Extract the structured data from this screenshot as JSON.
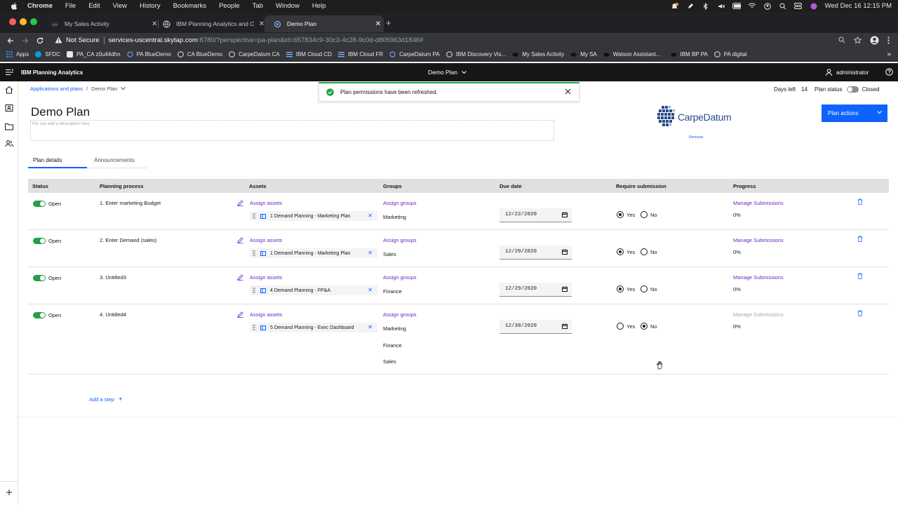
{
  "macos": {
    "app": "Chrome",
    "menus": [
      "File",
      "Edit",
      "View",
      "History",
      "Bookmarks",
      "People",
      "Tab",
      "Window",
      "Help"
    ],
    "clock": "Wed Dec 16  12:15 PM"
  },
  "browser": {
    "tabs": [
      {
        "title": "My Sales Activity"
      },
      {
        "title": "IBM Planning Analytics and Co"
      },
      {
        "title": "Demo Plan"
      }
    ],
    "security": "Not Secure",
    "url_host": "services-uscentral.skytap.com",
    "url_path": ":8780/?perspective=pa-plan&id=657834c9-30c3-4c28-9c0d-d805963d1846#",
    "bookmarks": [
      "Apps",
      "SFDC",
      "PA_CA z0u44dhn",
      "PA BlueDemo",
      "CA BlueDemo",
      "CarpeDatum CA",
      "IBM Cloud CD",
      "IBM Cloud FR",
      "CarpeDatum PA",
      "IBM Discovery Vis...",
      "My Sales Activity",
      "My SA",
      "Watson Assistant...",
      "IBM BP PA",
      "PA digital"
    ]
  },
  "app": {
    "brand": "IBM Planning Analytics",
    "plan_selector": "Demo Plan",
    "user": "administrator"
  },
  "breadcrumb": {
    "root": "Applications and plans",
    "current": "Demo Plan"
  },
  "toast": {
    "message": "Plan permissions have been refreshed."
  },
  "plan_status": {
    "days_left_label": "Days left",
    "days_left": "14",
    "status_label": "Plan status",
    "status": "Closed"
  },
  "plan": {
    "title": "Demo Plan",
    "description_placeholder": "You can add a description here",
    "logo_text": "CarpeDatum",
    "remove_label": "Remove",
    "actions_label": "Plan actions"
  },
  "tabs": [
    "Plan details",
    "Announcements"
  ],
  "columns": [
    "Status",
    "Planning process",
    "Assets",
    "Groups",
    "Due date",
    "Require submission",
    "Progress"
  ],
  "labels": {
    "assign_assets": "Assign assets",
    "assign_groups": "Assign groups",
    "manage_submissions": "Manage Submissions",
    "yes": "Yes",
    "no": "No",
    "add_step": "Add a step"
  },
  "rows": [
    {
      "status": "Open",
      "process": "1. Enter marketing Budget",
      "asset": "1 Demand Planning - Marketing Plan",
      "groups": [
        "Marketing"
      ],
      "due": "12/22/2020",
      "require": "Yes",
      "progress": "0%"
    },
    {
      "status": "Open",
      "process": "2. Enter Demand (sales)",
      "asset": "1 Demand Planning - Marketing Plan",
      "groups": [
        "Sales"
      ],
      "due": "12/29/2020",
      "require": "Yes",
      "progress": "0%"
    },
    {
      "status": "Open",
      "process": "3. Untitled3",
      "asset": "4 Demand Planning - FP&A",
      "groups": [
        "Finance"
      ],
      "due": "12/29/2020",
      "require": "Yes",
      "progress": "0%"
    },
    {
      "status": "Open",
      "process": "4. Untitled4",
      "asset": "5 Demand Planning - Exec Dashboard",
      "groups": [
        "Marketing",
        "Finance",
        "Sales"
      ],
      "due": "12/30/2020",
      "require": "No",
      "progress": "0%"
    }
  ]
}
